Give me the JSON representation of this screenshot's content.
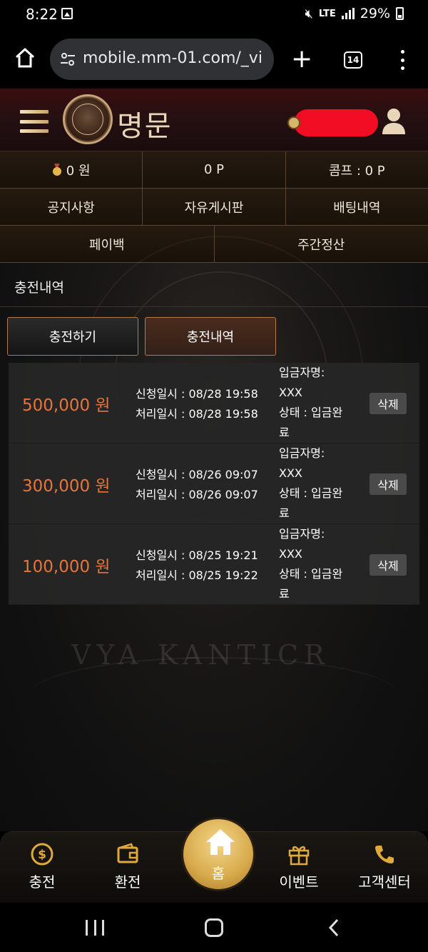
{
  "status": {
    "time": "8:22",
    "network": "LTE",
    "battery": "29%"
  },
  "browser": {
    "url": "mobile.mm-01.com/_vi",
    "tab_count": "14"
  },
  "site": {
    "logo_text": "명문"
  },
  "info": {
    "money": "0 원",
    "points": "0 P",
    "comp": "콤프 : 0 P"
  },
  "menu": {
    "notice": "공지사항",
    "board": "자유게시판",
    "betting": "배팅내역",
    "payback": "페이백",
    "weekly": "주간정산"
  },
  "page_title": "충전내역",
  "tabs": {
    "charge": "충전하기",
    "history": "충전내역"
  },
  "records": [
    {
      "amount": "500,000 원",
      "request": "신청일시 : 08/28 19:58",
      "processed": "처리일시 : 08/28 19:58",
      "depositor_label": "입금자명:",
      "depositor": "XXX",
      "status_line1": "상태 : 입금완",
      "status_line2": "료",
      "delete": "삭제"
    },
    {
      "amount": "300,000 원",
      "request": "신청일시 : 08/26 09:07",
      "processed": "처리일시 : 08/26 09:07",
      "depositor_label": "입금자명:",
      "depositor": "XXX",
      "status_line1": "상태 : 입금완",
      "status_line2": "료",
      "delete": "삭제"
    },
    {
      "amount": "100,000 원",
      "request": "신청일시 : 08/25 19:21",
      "processed": "처리일시 : 08/25 19:22",
      "depositor_label": "입금자명:",
      "depositor": "XXX",
      "status_line1": "상태 : 입금완",
      "status_line2": "료",
      "delete": "삭제"
    }
  ],
  "background_text": "VYA KANTICR",
  "bottom_nav": {
    "charge": "충전",
    "exchange": "환전",
    "home": "홈",
    "event": "이벤트",
    "support": "고객센터"
  },
  "colors": {
    "accent": "#e8743c",
    "gold": "#d7a94a",
    "border": "#5b4430"
  }
}
